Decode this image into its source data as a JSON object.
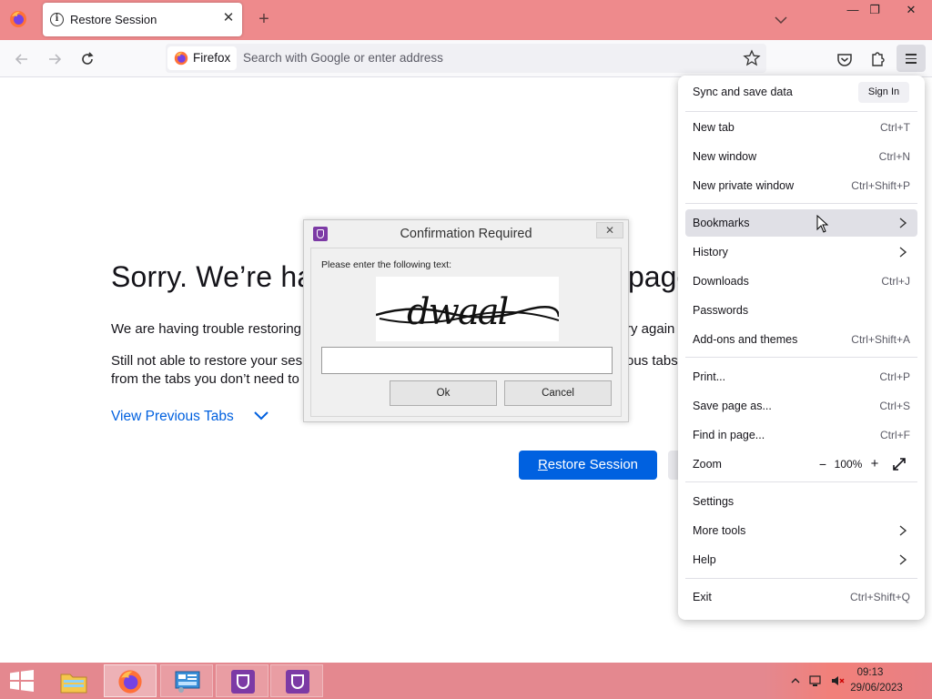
{
  "browser": {
    "tab": {
      "title": "Restore Session",
      "close": "✕"
    },
    "new_tab": "+",
    "window_controls": {
      "minimize": "—",
      "restore": "❐",
      "close": "✕"
    },
    "chip_label": "Firefox",
    "url_placeholder": "Search with Google or enter address"
  },
  "page": {
    "heading_left": "Sorry. We’re hav",
    "heading_right": "page",
    "line1_left": "We are having trouble restoring",
    "line1_right": "ry again",
    "line2_left": "Still not able to restore your ses",
    "line2_right": "ous tabs,",
    "line3_left": "from the tabs you don’t need to",
    "view_previous_tabs": "View Previous Tabs",
    "restore_button_prefix": "R",
    "restore_button_rest": "estore Session"
  },
  "dialog": {
    "title": "Confirmation Required",
    "close": "✕",
    "prompt": "Please enter the following text:",
    "captcha_text": "dwaal",
    "input_value": "",
    "ok_label": "Ok",
    "cancel_label": "Cancel"
  },
  "app_menu": {
    "sync_label": "Sync and save data",
    "sign_in_label": "Sign In",
    "items": [
      {
        "label": "New tab",
        "shortcut": "Ctrl+T"
      },
      {
        "label": "New window",
        "shortcut": "Ctrl+N"
      },
      {
        "label": "New private window",
        "shortcut": "Ctrl+Shift+P"
      },
      {
        "label": "Bookmarks",
        "shortcut": ""
      },
      {
        "label": "History",
        "shortcut": ""
      },
      {
        "label": "Downloads",
        "shortcut": "Ctrl+J"
      },
      {
        "label": "Passwords",
        "shortcut": ""
      },
      {
        "label": "Add-ons and themes",
        "shortcut": "Ctrl+Shift+A"
      },
      {
        "label": "Print...",
        "shortcut": "Ctrl+P"
      },
      {
        "label": "Save page as...",
        "shortcut": "Ctrl+S"
      },
      {
        "label": "Find in page...",
        "shortcut": "Ctrl+F"
      },
      {
        "label": "Zoom",
        "shortcut": ""
      },
      {
        "label": "Settings",
        "shortcut": ""
      },
      {
        "label": "More tools",
        "shortcut": ""
      },
      {
        "label": "Help",
        "shortcut": ""
      },
      {
        "label": "Exit",
        "shortcut": "Ctrl+Shift+Q"
      }
    ],
    "zoom": {
      "minus": "−",
      "value": "100%",
      "plus": "+"
    }
  },
  "taskbar": {
    "time": "09:13",
    "date": "29/06/2023"
  },
  "colors": {
    "tabbar": "#ee8a8c",
    "taskbar": "#e4888f",
    "accent_blue": "#0061e0",
    "link_blue": "#0060df",
    "captcha_app_purple": "#7c3aa5"
  }
}
